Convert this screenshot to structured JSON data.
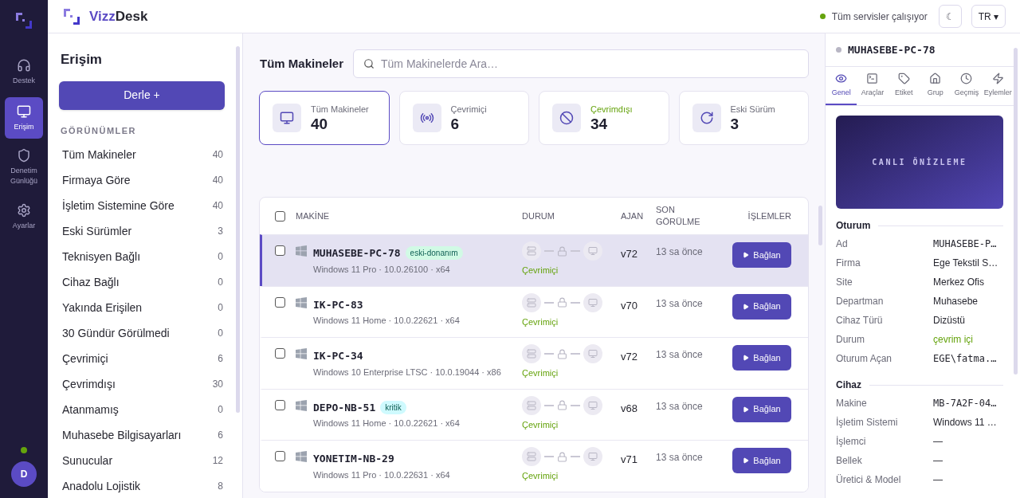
{
  "brand": {
    "part1": "Vizz",
    "part2": "Desk"
  },
  "rail": {
    "items": [
      {
        "label": "Destek",
        "selected": false
      },
      {
        "label": "Erişim",
        "selected": true
      },
      {
        "label": "Denetim Günlüğü",
        "selected": false
      },
      {
        "label": "Ayarlar",
        "selected": false
      }
    ],
    "avatar": "D"
  },
  "header": {
    "status": "Tüm servisler çalışıyor",
    "theme_toggle": "☾",
    "language": "TR ▾"
  },
  "sidebar": {
    "title": "Erişim",
    "button": "Derle +",
    "section": "GÖRÜNÜMLER",
    "views": [
      {
        "label": "Tüm Makineler",
        "count": "40"
      },
      {
        "label": "Firmaya Göre",
        "count": "40"
      },
      {
        "label": "İşletim Sistemine Göre",
        "count": "40"
      },
      {
        "label": "Eski Sürümler",
        "count": "3"
      },
      {
        "label": "Teknisyen Bağlı",
        "count": "0"
      },
      {
        "label": "Cihaz Bağlı",
        "count": "0"
      },
      {
        "label": "Yakında Erişilen",
        "count": "0"
      },
      {
        "label": "30 Gündür Görülmedi",
        "count": "0"
      },
      {
        "label": "Çevrimiçi",
        "count": "6"
      },
      {
        "label": "Çevrimdışı",
        "count": "30"
      },
      {
        "label": "Atanmamış",
        "count": "0"
      },
      {
        "label": "Muhasebe Bilgisayarları",
        "count": "6"
      },
      {
        "label": "Sunucular",
        "count": "12"
      },
      {
        "label": "Anadolu Lojistik",
        "count": "8"
      }
    ]
  },
  "main": {
    "title": "Tüm Makineler",
    "search": {
      "placeholder": "Tüm Makinelerde Ara…"
    },
    "stats": [
      {
        "label": "Tüm Makineler",
        "value": "40",
        "selected": true,
        "color": "#6b6b78"
      },
      {
        "label": "Çevrimiçi",
        "value": "6",
        "selected": false,
        "color": "#6b6b78"
      },
      {
        "label": "Çevrimdışı",
        "value": "34",
        "selected": false,
        "color": "#65a30d"
      },
      {
        "label": "Eski Sürüm",
        "value": "3",
        "selected": false,
        "color": "#6b6b78"
      }
    ],
    "table": {
      "columns": [
        "MAKİNE",
        "DURUM",
        "AJAN",
        "SON GÖRÜLME",
        "İŞLEMLER"
      ],
      "header_checked": false,
      "rows": [
        {
          "name": "MUHASEBE-PC-78",
          "tag": {
            "text": "eski-donanım",
            "color": "#d1fae5"
          },
          "os": "Windows 11 Pro · 10.0.26100 · x64",
          "status": "Çevrimiçi",
          "agent": "v72",
          "seen": "13 sa önce",
          "action": "Bağlan",
          "selected": true,
          "checked": false
        },
        {
          "name": "IK-PC-83",
          "os": "Windows 11 Home · 10.0.22621 · x64",
          "status": "Çevrimiçi",
          "agent": "v70",
          "seen": "13 sa önce",
          "action": "Bağlan",
          "selected": false,
          "checked": false
        },
        {
          "name": "IK-PC-34",
          "os": "Windows 10 Enterprise LTSC · 10.0.19044 · x86",
          "status": "Çevrimiçi",
          "agent": "v72",
          "seen": "13 sa önce",
          "action": "Bağlan",
          "selected": false,
          "checked": false
        },
        {
          "name": "DEPO-NB-51",
          "tag": {
            "text": "kritik",
            "color": "#cffafe"
          },
          "os": "Windows 11 Home · 10.0.22621 · x64",
          "status": "Çevrimiçi",
          "agent": "v68",
          "seen": "13 sa önce",
          "action": "Bağlan",
          "selected": false,
          "checked": false
        },
        {
          "name": "YONETIM-NB-29",
          "os": "Windows 11 Pro · 10.0.22631 · x64",
          "status": "Çevrimiçi",
          "agent": "v71",
          "seen": "13 sa önce",
          "action": "Bağlan",
          "selected": false,
          "checked": false
        }
      ]
    }
  },
  "detail": {
    "title": "MUHASEBE-PC-78",
    "tabs": [
      {
        "label": "Genel",
        "selected": true
      },
      {
        "label": "Araçlar",
        "selected": false
      },
      {
        "label": "Etiket",
        "selected": false
      },
      {
        "label": "Grup",
        "selected": false
      },
      {
        "label": "Geçmiş",
        "selected": false
      },
      {
        "label": "Eylemler",
        "selected": false
      }
    ],
    "preview": "CANLI ÖNİZLEME",
    "sections": [
      {
        "title": "Oturum",
        "rows": [
          {
            "label": "Ad",
            "value": "MUHASEBE-P…",
            "kind": "code"
          },
          {
            "label": "Firma",
            "value": "Ege Tekstil S…",
            "kind": "text"
          },
          {
            "label": "Site",
            "value": "Merkez Ofis",
            "kind": "text"
          },
          {
            "label": "Departman",
            "value": "Muhasebe",
            "kind": "text"
          },
          {
            "label": "Cihaz Türü",
            "value": "Dizüstü",
            "kind": "text"
          },
          {
            "label": "Durum",
            "value": "çevrim içi",
            "kind": "status"
          },
          {
            "label": "Oturum Açan",
            "value": "EGE\\fatma.…",
            "kind": "code"
          }
        ]
      },
      {
        "title": "Cihaz",
        "rows": [
          {
            "label": "Makine",
            "value": "MB-7A2F-04…",
            "kind": "code"
          },
          {
            "label": "İşletim Sistemi",
            "value": "Windows 11 …",
            "kind": "text"
          },
          {
            "label": "İşlemci",
            "value": "—",
            "kind": "text"
          },
          {
            "label": "Bellek",
            "value": "—",
            "kind": "text"
          },
          {
            "label": "Üretici & Model",
            "value": "—",
            "kind": "text"
          }
        ]
      }
    ]
  }
}
